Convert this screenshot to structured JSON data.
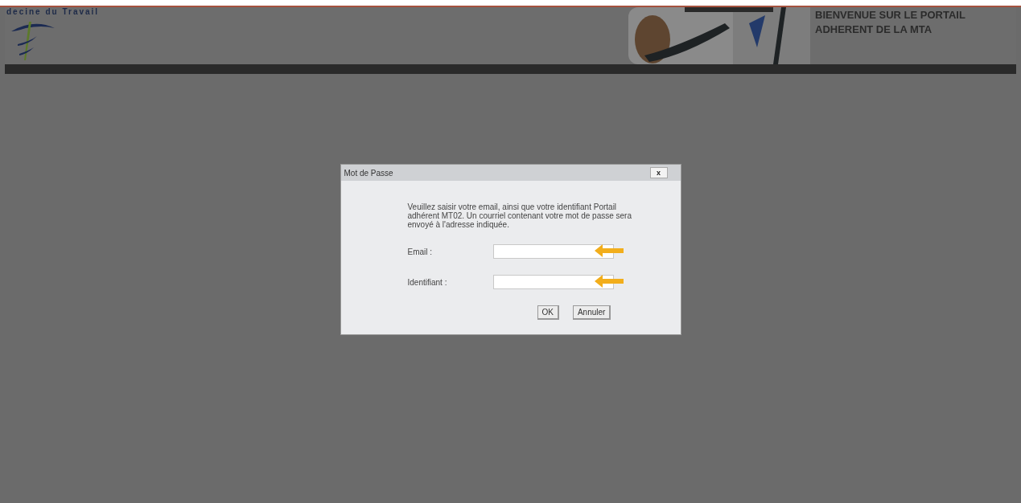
{
  "header": {
    "logo_text": "decine du Travail",
    "welcome": [
      "BIENVENUE SUR LE PORTAIL",
      "ADHERENT DE LA MTA"
    ]
  },
  "dialog": {
    "title": "Mot de Passe",
    "close": "x",
    "message": "Veuillez saisir votre email, ainsi que votre identifiant Portail adhérent MT02. Un courriel contenant votre mot de passe sera envoyé à l'adresse indiquée.",
    "fields": [
      {
        "label": "Email :",
        "highlighted": true
      },
      {
        "label": "Identifiant :",
        "highlighted": true
      }
    ],
    "buttons": [
      "OK",
      "Annuler"
    ]
  }
}
